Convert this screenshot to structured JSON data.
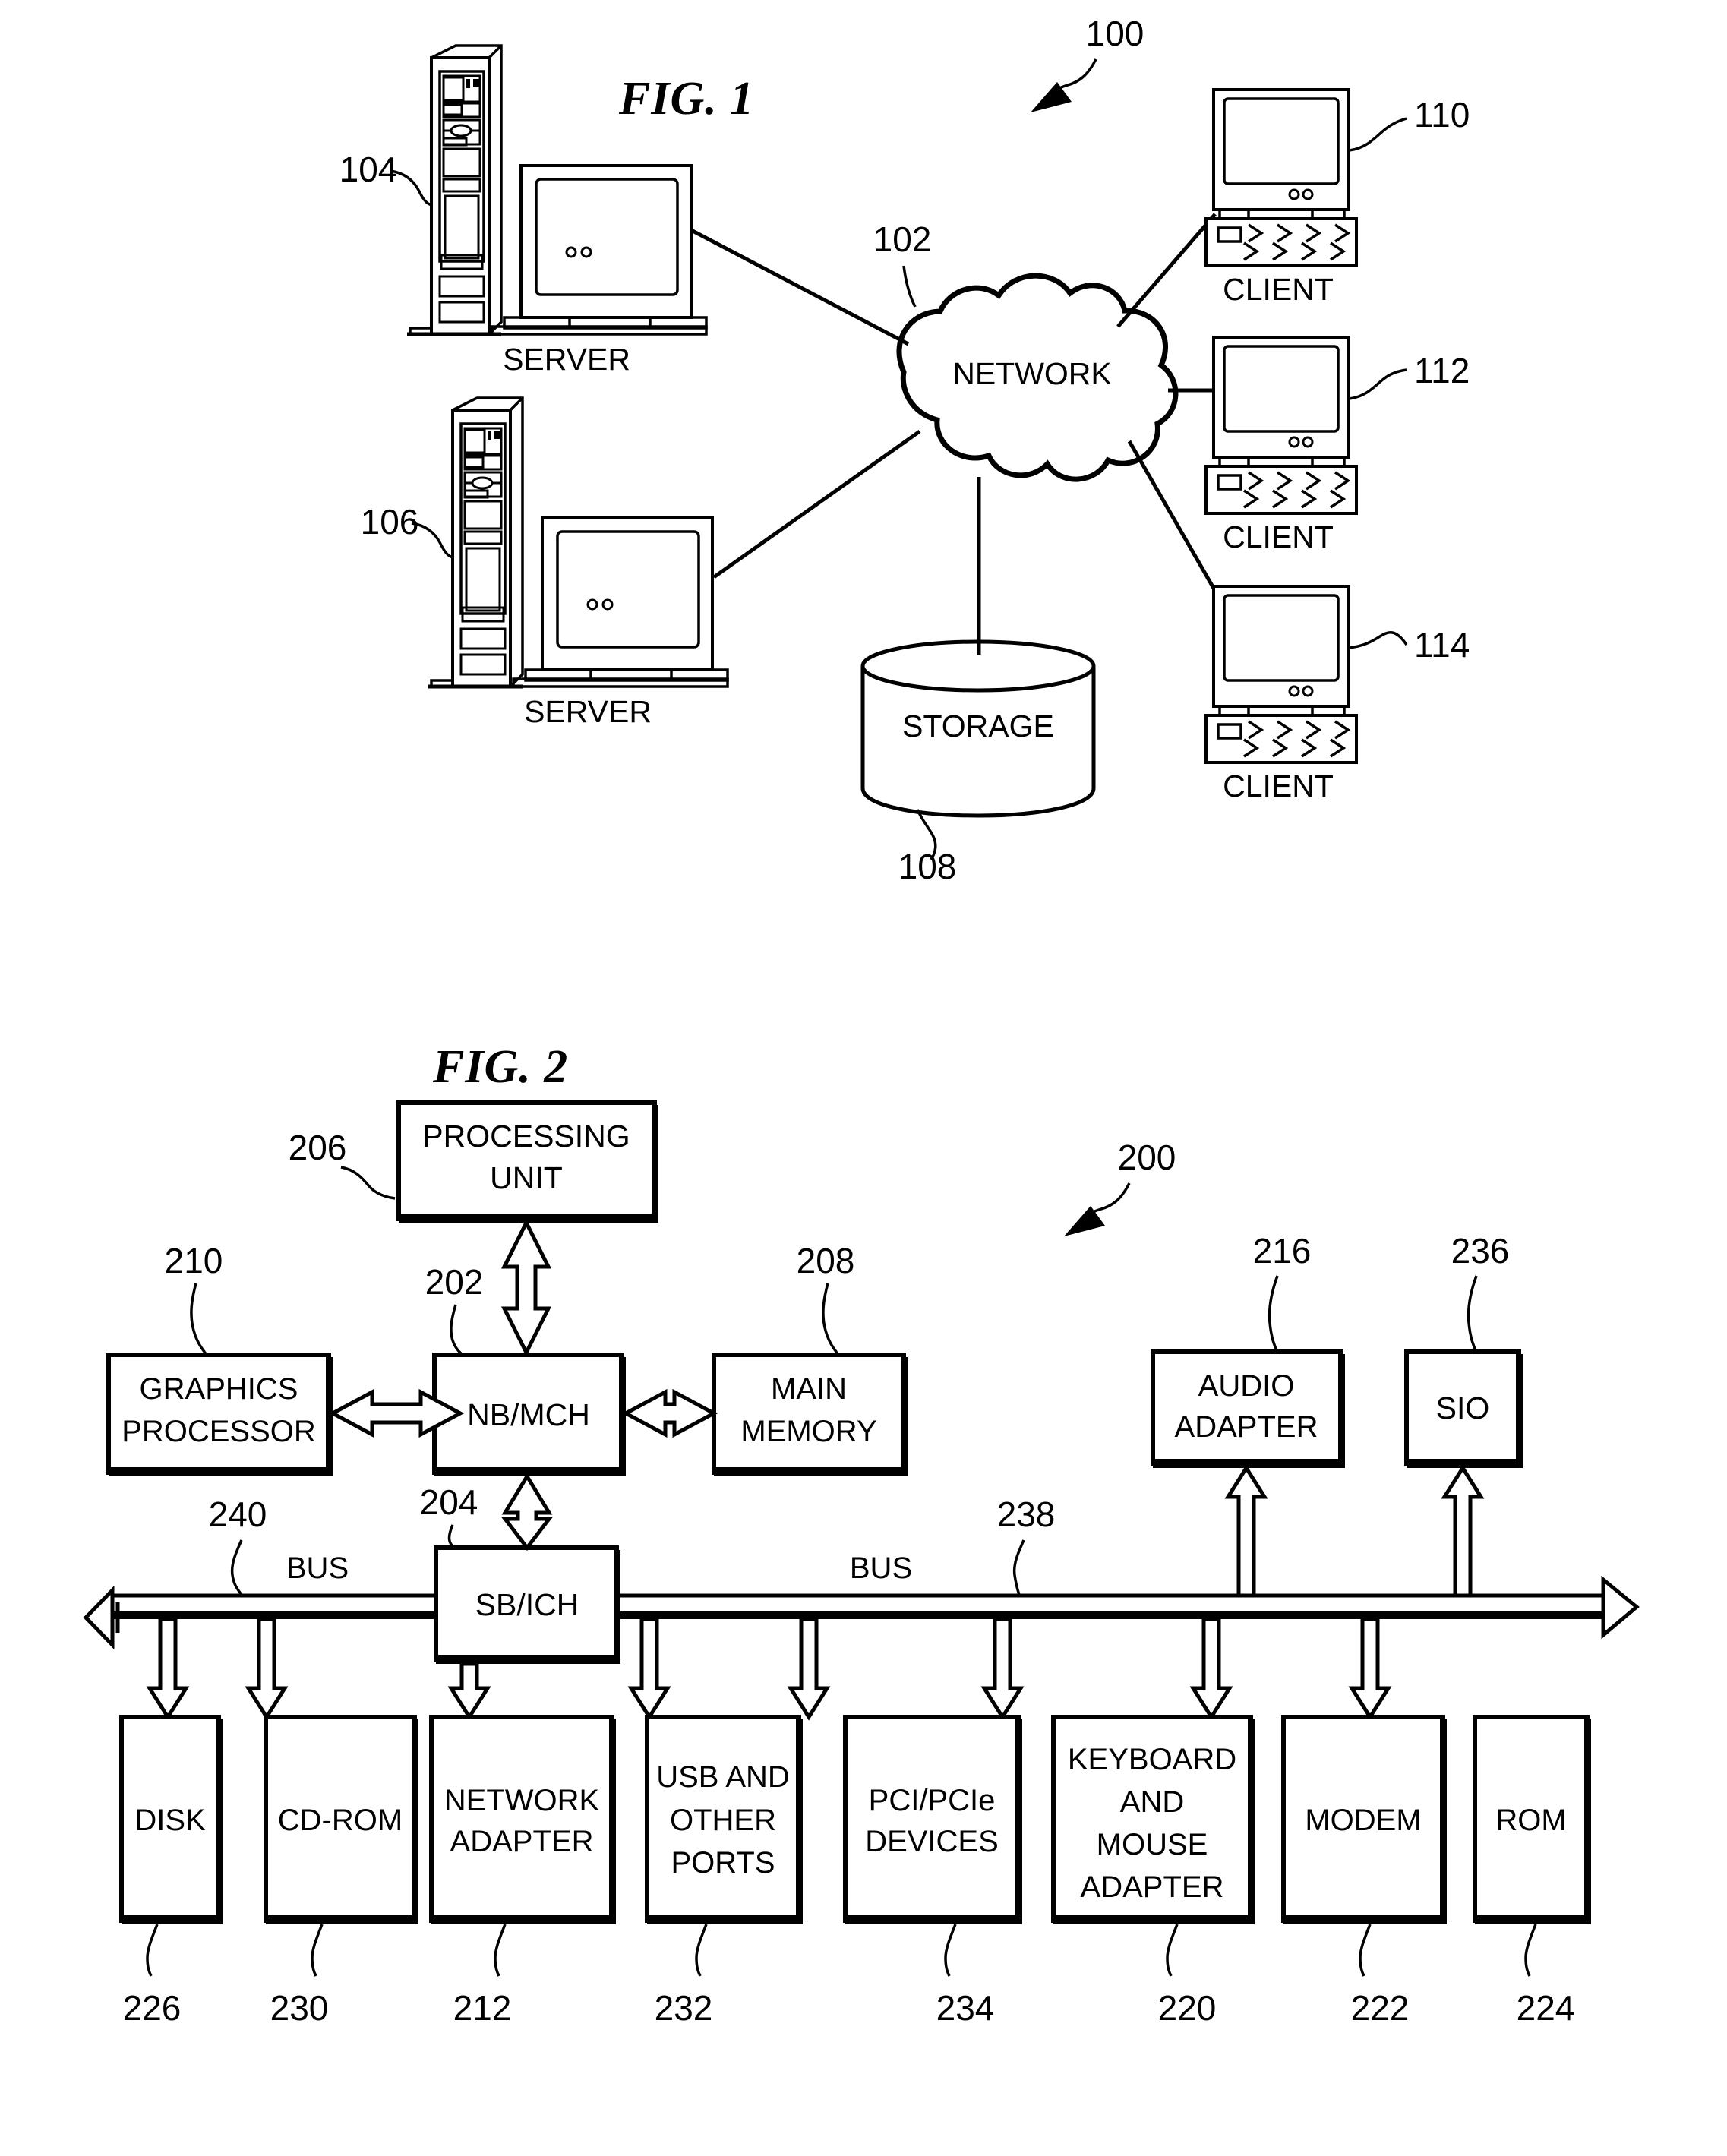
{
  "figure1": {
    "title": "FIG. 1",
    "system_ref": "100",
    "network": {
      "label": "NETWORK",
      "ref": "102"
    },
    "storage": {
      "label": "STORAGE",
      "ref": "108"
    },
    "servers": [
      {
        "label": "SERVER",
        "ref": "104"
      },
      {
        "label": "SERVER",
        "ref": "106"
      }
    ],
    "clients": [
      {
        "label": "CLIENT",
        "ref": "110"
      },
      {
        "label": "CLIENT",
        "ref": "112"
      },
      {
        "label": "CLIENT",
        "ref": "114"
      }
    ]
  },
  "figure2": {
    "title": "FIG. 2",
    "system_ref": "200",
    "processing_unit": {
      "label_line1": "PROCESSING",
      "label_line2": "UNIT",
      "ref": "206"
    },
    "pu_link_ref": "202",
    "graphics_processor": {
      "label_line1": "GRAPHICS",
      "label_line2": "PROCESSOR",
      "ref": "210"
    },
    "nb_mch": {
      "label": "NB/MCH"
    },
    "main_memory": {
      "label_line1": "MAIN",
      "label_line2": "MEMORY",
      "ref": "208"
    },
    "audio_adapter": {
      "label_line1": "AUDIO",
      "label_line2": "ADAPTER",
      "ref": "216"
    },
    "sio": {
      "label": "SIO",
      "ref": "236"
    },
    "sb_ich": {
      "label": "SB/ICH",
      "ref": "204"
    },
    "bus_left": {
      "label": "BUS",
      "ref": "240"
    },
    "bus_right": {
      "label": "BUS",
      "ref": "238"
    },
    "devices": [
      {
        "lines": [
          "DISK"
        ],
        "ref": "226"
      },
      {
        "lines": [
          "CD-ROM"
        ],
        "ref": "230"
      },
      {
        "lines": [
          "NETWORK",
          "ADAPTER"
        ],
        "ref": "212"
      },
      {
        "lines": [
          "USB AND",
          "OTHER",
          "PORTS"
        ],
        "ref": "232"
      },
      {
        "lines": [
          "PCI/PCIe",
          "DEVICES"
        ],
        "ref": "234"
      },
      {
        "lines": [
          "KEYBOARD",
          "AND",
          "MOUSE",
          "ADAPTER"
        ],
        "ref": "220"
      },
      {
        "lines": [
          "MODEM"
        ],
        "ref": "222"
      },
      {
        "lines": [
          "ROM"
        ],
        "ref": "224"
      }
    ]
  },
  "colors": {
    "ink": "#000000",
    "paper": "#ffffff"
  }
}
